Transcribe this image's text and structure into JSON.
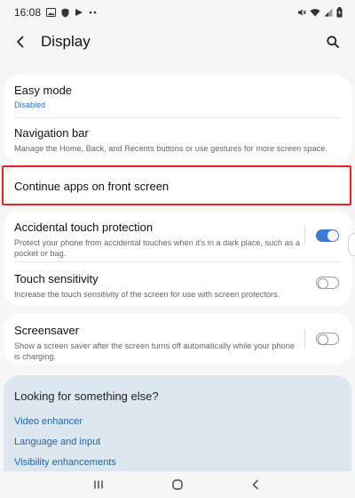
{
  "status_bar": {
    "time": "16:08",
    "icons_left": [
      "image-icon",
      "shield-icon",
      "play-icon",
      "more-dots-icon"
    ],
    "icons_right": [
      "mute-icon",
      "wifi-icon",
      "signal-icon",
      "battery-icon"
    ]
  },
  "header": {
    "title": "Display"
  },
  "settings": {
    "easy_mode": {
      "title": "Easy mode",
      "subtitle": "Disabled"
    },
    "navigation_bar": {
      "title": "Navigation bar",
      "subtitle": "Manage the Home, Back, and Recents buttons or use gestures for more screen space."
    },
    "continue_apps": {
      "title": "Continue apps on front screen"
    },
    "accidental_touch": {
      "title": "Accidental touch protection",
      "subtitle": "Protect your phone from accidental touches when it's in a dark place, such as a pocket or bag.",
      "enabled": true
    },
    "touch_sensitivity": {
      "title": "Touch sensitivity",
      "subtitle": "Increase the touch sensitivity of the screen for use with screen protectors.",
      "enabled": false
    },
    "screensaver": {
      "title": "Screensaver",
      "subtitle": "Show a screen saver after the screen turns off automatically while your phone is charging.",
      "enabled": false
    }
  },
  "suggestions": {
    "title": "Looking for something else?",
    "links": [
      "Video enhancer",
      "Language and input",
      "Visibility enhancements"
    ]
  },
  "colors": {
    "accent": "#3a7bd5",
    "link": "#1f65a8",
    "highlight": "#e0262c",
    "suggest_bg": "#dde7f0"
  }
}
